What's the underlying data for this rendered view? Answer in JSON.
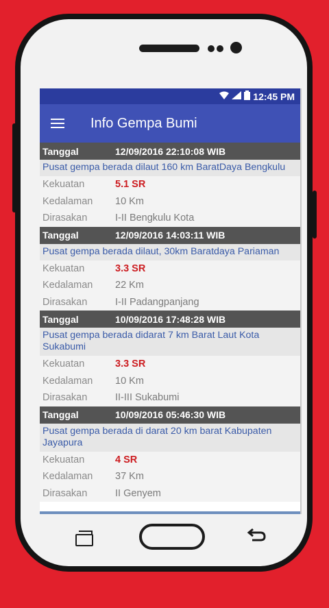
{
  "status": {
    "wifi_icon": "wifi-icon",
    "signal_icon": "signal-icon",
    "battery_icon": "battery-icon",
    "time": "12:45 PM"
  },
  "appbar": {
    "menu_icon": "hamburger-menu-icon",
    "title": "Info Gempa Bumi"
  },
  "labels": {
    "tanggal": "Tanggal",
    "kekuatan": "Kekuatan",
    "kedalaman": "Kedalaman",
    "dirasakan": "Dirasakan"
  },
  "earthquakes": [
    {
      "datetime": "12/09/2016  22:10:08 WIB",
      "location": "Pusat gempa berada dilaut 160 km BaratDaya Bengkulu",
      "magnitude": "5.1 SR",
      "depth": "10 Km",
      "felt": "I-II Bengkulu Kota"
    },
    {
      "datetime": "12/09/2016  14:03:11 WIB",
      "location": "Pusat gempa berada dilaut, 30km Baratdaya Pariaman",
      "magnitude": "3.3 SR",
      "depth": "22 Km",
      "felt": "I-II Padangpanjang"
    },
    {
      "datetime": "10/09/2016  17:48:28 WIB",
      "location": "Pusat gempa berada didarat 7 km Barat Laut Kota Sukabumi",
      "magnitude": "3.3 SR",
      "depth": "10 Km",
      "felt": "II-III Sukabumi"
    },
    {
      "datetime": "10/09/2016  05:46:30 WIB",
      "location": "Pusat gempa berada di darat 20 km barat Kabupaten Jayapura",
      "magnitude": "4 SR",
      "depth": "37 Km",
      "felt": "II Genyem"
    }
  ],
  "nav": {
    "recent_icon": "recent-apps-icon",
    "home_icon": "home-icon",
    "back_icon": "back-icon"
  },
  "colors": {
    "background": "#e2202c",
    "appbar": "#3f51b5",
    "statusbar": "#2b3c9e",
    "magnitude": "#cc1c20",
    "location_text": "#3a5ba8"
  }
}
